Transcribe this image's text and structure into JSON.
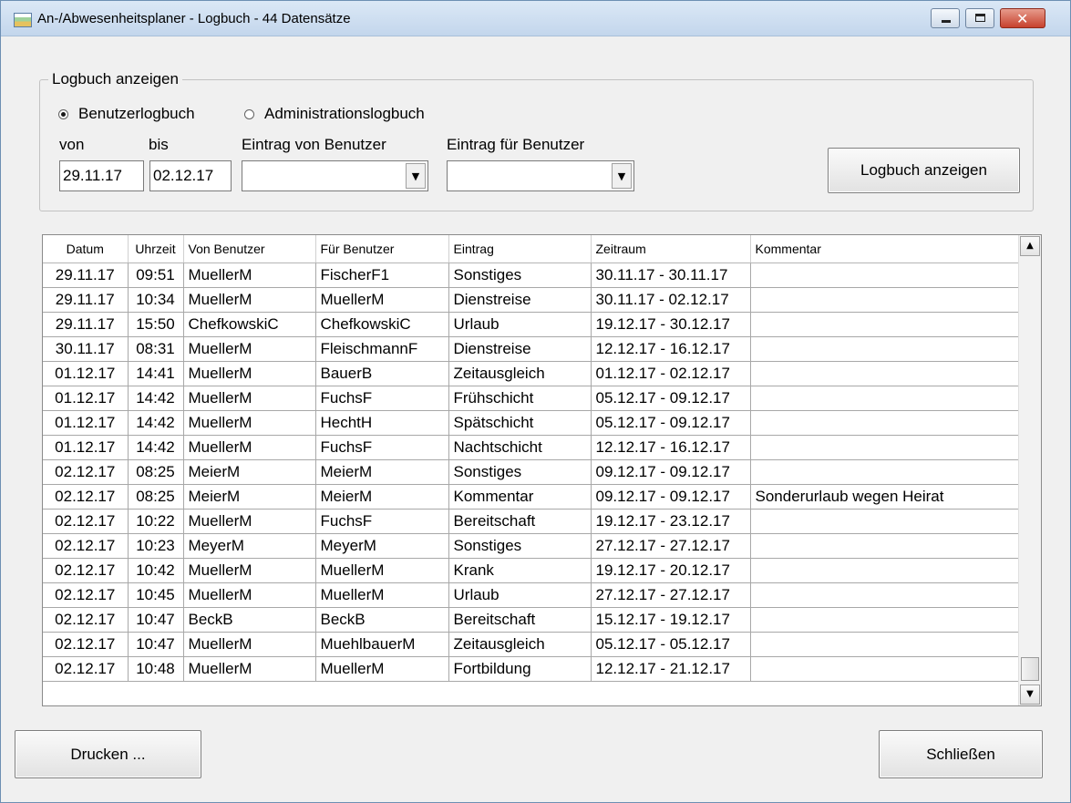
{
  "window": {
    "title": "An-/Abwesenheitsplaner - Logbuch - 44 Datensätze"
  },
  "group": {
    "title": "Logbuch anzeigen",
    "radio_user": "Benutzerlogbuch",
    "radio_admin": "Administrationslogbuch",
    "selected": "Benutzerlogbuch",
    "label_from": "von",
    "label_to": "bis",
    "label_entry_by": "Eintrag von Benutzer",
    "label_entry_for": "Eintrag für Benutzer",
    "from_value": "29.11.17",
    "to_value": "02.12.17",
    "entry_by_value": "",
    "entry_for_value": "",
    "show_button": "Logbuch anzeigen"
  },
  "table": {
    "columns": [
      "Datum",
      "Uhrzeit",
      "Von Benutzer",
      "Für Benutzer",
      "Eintrag",
      "Zeitraum",
      "Kommentar"
    ],
    "rows": [
      [
        "29.11.17",
        "09:51",
        "MuellerM",
        "FischerF1",
        "Sonstiges",
        "30.11.17 - 30.11.17",
        ""
      ],
      [
        "29.11.17",
        "10:34",
        "MuellerM",
        "MuellerM",
        "Dienstreise",
        "30.11.17 - 02.12.17",
        ""
      ],
      [
        "29.11.17",
        "15:50",
        "ChefkowskiC",
        "ChefkowskiC",
        "Urlaub",
        "19.12.17 - 30.12.17",
        ""
      ],
      [
        "30.11.17",
        "08:31",
        "MuellerM",
        "FleischmannF",
        "Dienstreise",
        "12.12.17 - 16.12.17",
        ""
      ],
      [
        "01.12.17",
        "14:41",
        "MuellerM",
        "BauerB",
        "Zeitausgleich",
        "01.12.17 - 02.12.17",
        ""
      ],
      [
        "01.12.17",
        "14:42",
        "MuellerM",
        "FuchsF",
        "Frühschicht",
        "05.12.17 - 09.12.17",
        ""
      ],
      [
        "01.12.17",
        "14:42",
        "MuellerM",
        "HechtH",
        "Spätschicht",
        "05.12.17 - 09.12.17",
        ""
      ],
      [
        "01.12.17",
        "14:42",
        "MuellerM",
        "FuchsF",
        "Nachtschicht",
        "12.12.17 - 16.12.17",
        ""
      ],
      [
        "02.12.17",
        "08:25",
        "MeierM",
        "MeierM",
        "Sonstiges",
        "09.12.17 - 09.12.17",
        ""
      ],
      [
        "02.12.17",
        "08:25",
        "MeierM",
        "MeierM",
        "Kommentar",
        "09.12.17 - 09.12.17",
        "Sonderurlaub wegen Heirat"
      ],
      [
        "02.12.17",
        "10:22",
        "MuellerM",
        "FuchsF",
        "Bereitschaft",
        "19.12.17 - 23.12.17",
        ""
      ],
      [
        "02.12.17",
        "10:23",
        "MeyerM",
        "MeyerM",
        "Sonstiges",
        "27.12.17 - 27.12.17",
        ""
      ],
      [
        "02.12.17",
        "10:42",
        "MuellerM",
        "MuellerM",
        "Krank",
        "19.12.17 - 20.12.17",
        ""
      ],
      [
        "02.12.17",
        "10:45",
        "MuellerM",
        "MuellerM",
        "Urlaub",
        "27.12.17 - 27.12.17",
        ""
      ],
      [
        "02.12.17",
        "10:47",
        "BeckB",
        "BeckB",
        "Bereitschaft",
        "15.12.17 - 19.12.17",
        ""
      ],
      [
        "02.12.17",
        "10:47",
        "MuellerM",
        "MuehlbauerM",
        "Zeitausgleich",
        "05.12.17 - 05.12.17",
        ""
      ],
      [
        "02.12.17",
        "10:48",
        "MuellerM",
        "MuellerM",
        "Fortbildung",
        "12.12.17 - 21.12.17",
        ""
      ]
    ]
  },
  "footer": {
    "print_button": "Drucken ...",
    "close_button": "Schließen"
  }
}
